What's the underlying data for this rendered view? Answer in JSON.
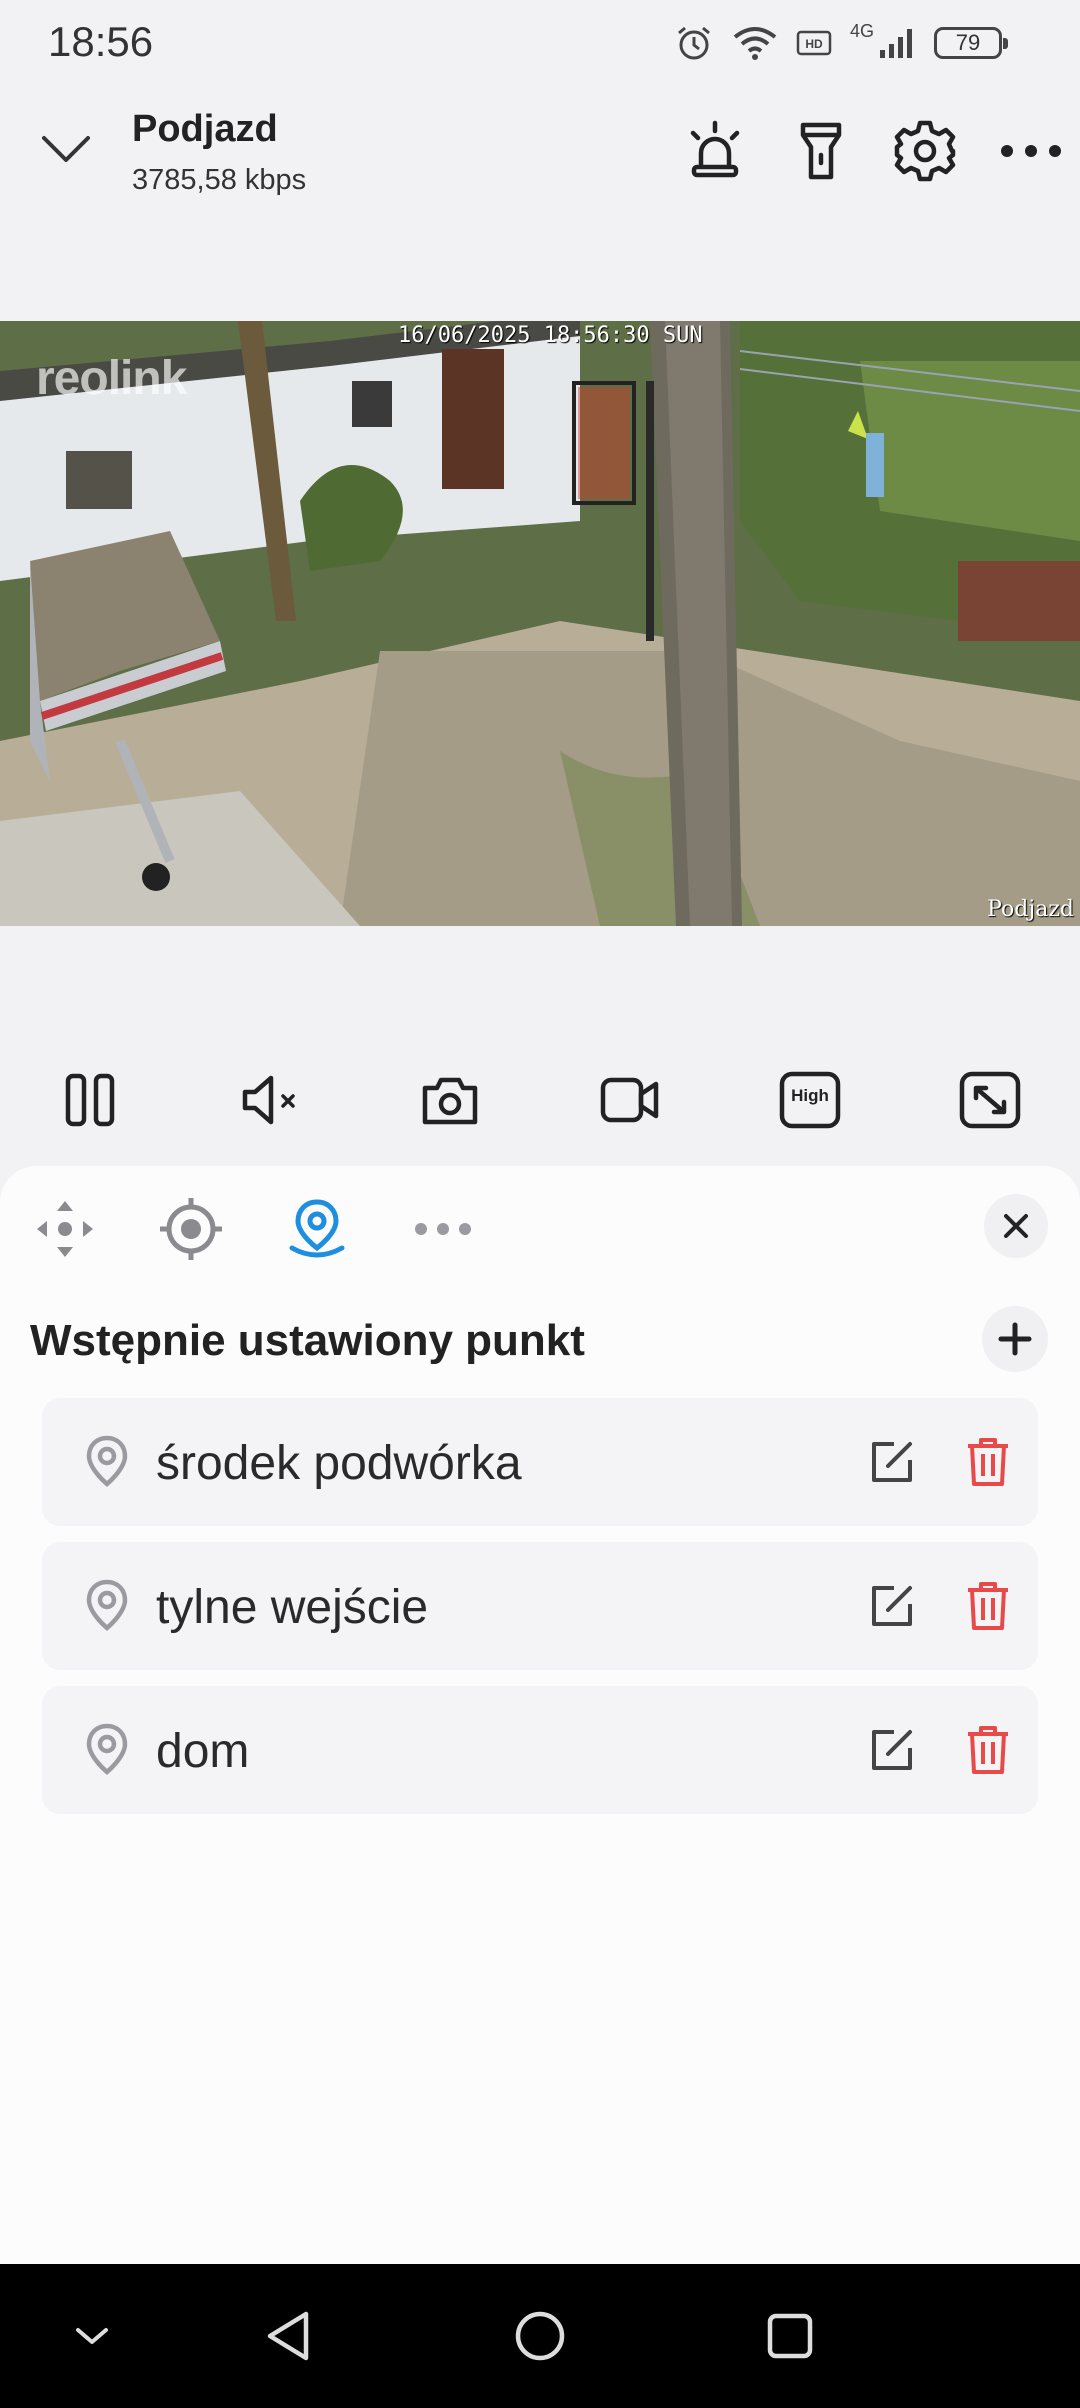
{
  "status_bar": {
    "time": "18:56",
    "network": "4G",
    "battery": "79",
    "icons": [
      "alarm-icon",
      "wifi-icon",
      "hd-icon",
      "signal-icon",
      "battery-icon"
    ]
  },
  "header": {
    "title": "Podjazd",
    "bitrate": "3785,58 kbps",
    "actions": [
      "siren-icon",
      "floodlight-icon",
      "settings-icon",
      "more-icon"
    ]
  },
  "video": {
    "osd_timestamp": "16/06/2025 18:56:30 SUN",
    "osd_logo": "reolink",
    "osd_camera_name": "Podjazd"
  },
  "controls": {
    "items": [
      "pause-icon",
      "mute-icon",
      "snapshot-icon",
      "record-icon",
      "quality-high-icon",
      "fullscreen-icon"
    ],
    "quality_label": "High"
  },
  "panel": {
    "tabs": [
      "ptz-arrows-icon",
      "focus-target-icon",
      "preset-location-icon",
      "more-dots-icon"
    ],
    "active_tab": "preset-location-icon",
    "accent": "#1e8fe0",
    "section_title": "Wstępnie ustawiony punkt",
    "presets": [
      {
        "name": "środek podwórka"
      },
      {
        "name": "tylne wejście"
      },
      {
        "name": "dom"
      }
    ],
    "delete_color": "#e84a4a"
  },
  "navbar": {
    "items": [
      "hide-keyboard-icon",
      "back-icon",
      "home-icon",
      "recents-icon"
    ]
  }
}
